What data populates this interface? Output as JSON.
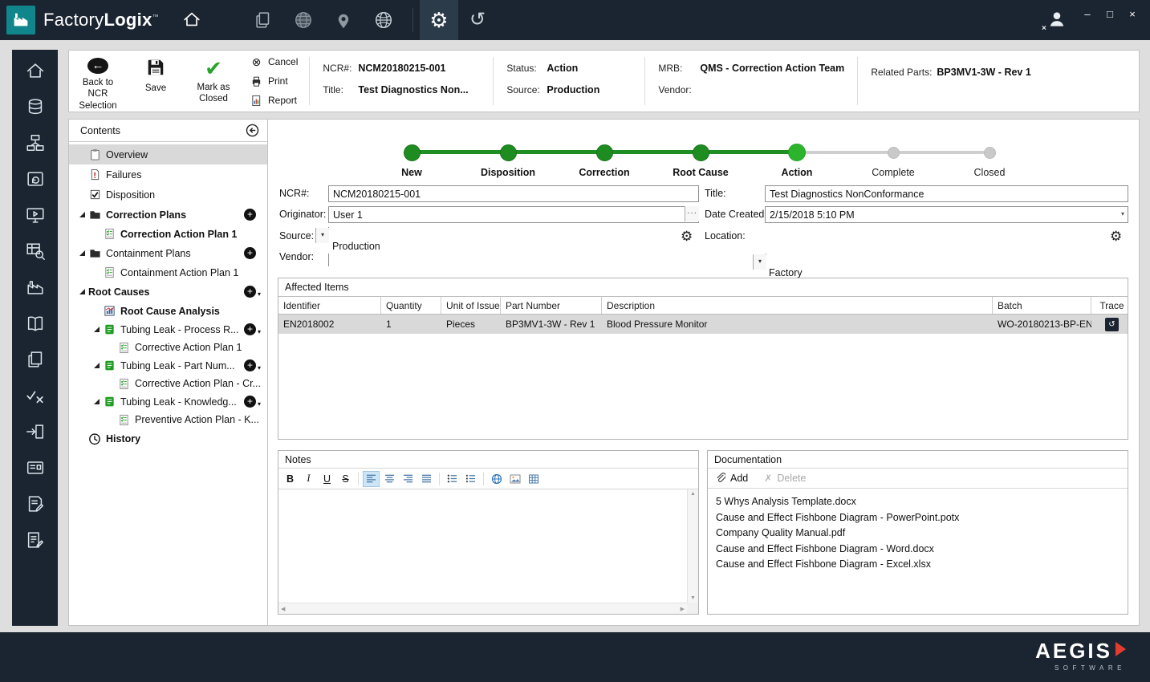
{
  "titlebar": {
    "app_name_regular": "Factory",
    "app_name_bold": "Logix",
    "trademark": "™"
  },
  "icons": {
    "gear": "⚙",
    "history": "↺",
    "back_arrow": "←",
    "cancel": "⊗",
    "check": "✔",
    "dropdown_arrow": "▾",
    "browse_ellipsis": "···",
    "minimize": "–",
    "maximize": "□",
    "close": "×",
    "scroll_up": "▲",
    "scroll_down": "▼",
    "scroll_left": "◀",
    "scroll_right": "▶",
    "trace": "↺",
    "delete_x": "✗",
    "add_plus": "+",
    "logout_x": "×"
  },
  "toolbar": {
    "back_line1": "Back to",
    "back_line2": "NCR Selection",
    "save": "Save",
    "mark_closed_line1": "Mark as",
    "mark_closed_line2": "Closed",
    "cancel": "Cancel",
    "print": "Print",
    "report": "Report",
    "info": {
      "ncr_label": "NCR#:",
      "ncr_value": "NCM20180215-001",
      "title_label": "Title:",
      "title_value": "Test Diagnostics Non...",
      "status_label": "Status:",
      "status_value": "Action",
      "source_label": "Source:",
      "source_value": "Production",
      "mrb_label": "MRB:",
      "mrb_value": "QMS - Correction Action Team",
      "vendor_label": "Vendor:",
      "vendor_value": "",
      "related_parts_label": "Related Parts:",
      "related_parts_value": "BP3MV1-3W  - Rev 1"
    }
  },
  "contents": {
    "header": "Contents",
    "items": [
      {
        "label": "Overview"
      },
      {
        "label": "Failures"
      },
      {
        "label": "Disposition"
      },
      {
        "label": "Correction Plans"
      },
      {
        "label": "Correction Action Plan 1"
      },
      {
        "label": "Containment Plans"
      },
      {
        "label": "Containment Action Plan 1"
      },
      {
        "label": "Root Causes"
      },
      {
        "label": "Root Cause Analysis"
      },
      {
        "label": "Tubing Leak - Process R..."
      },
      {
        "label": "Corrective Action Plan 1"
      },
      {
        "label": "Tubing Leak - Part Num..."
      },
      {
        "label": "Corrective Action Plan - Cr..."
      },
      {
        "label": "Tubing Leak - Knowledg..."
      },
      {
        "label": "Preventive Action Plan - K..."
      },
      {
        "label": "History"
      }
    ]
  },
  "stepper": {
    "steps": [
      {
        "label": "New"
      },
      {
        "label": "Disposition"
      },
      {
        "label": "Correction"
      },
      {
        "label": "Root Cause"
      },
      {
        "label": "Action"
      },
      {
        "label": "Complete"
      },
      {
        "label": "Closed"
      }
    ]
  },
  "form": {
    "ncr": {
      "label": "NCR#:",
      "value": "NCM20180215-001"
    },
    "title": {
      "label": "Title:",
      "value": "Test Diagnostics NonConformance"
    },
    "originator": {
      "label": "Originator:",
      "value": "User 1"
    },
    "date_created": {
      "label": "Date Created:",
      "value": "2/15/2018 5:10 PM"
    },
    "source": {
      "label": "Source:",
      "value": "Production"
    },
    "location": {
      "label": "Location:",
      "value": "Factory"
    },
    "vendor": {
      "label": "Vendor:",
      "value": ""
    }
  },
  "affected_items": {
    "title": "Affected Items",
    "columns": [
      "Identifier",
      "Quantity",
      "Unit of Issue",
      "Part Number",
      "Description",
      "Batch",
      "Trace"
    ],
    "rows": [
      {
        "identifier": "EN2018002",
        "quantity": "1",
        "unit_of_issue": "Pieces",
        "part_number": "BP3MV1-3W  - Rev 1",
        "description": "Blood Pressure Monitor",
        "batch": "WO-20180213-BP-EN"
      }
    ]
  },
  "notes": {
    "title": "Notes",
    "toolbar": {
      "bold": "B",
      "italic": "I",
      "underline": "U",
      "strikethrough": "S"
    }
  },
  "documentation": {
    "title": "Documentation",
    "add": "Add",
    "delete": "Delete",
    "files": [
      "5 Whys Analysis Template.docx",
      "Cause and Effect Fishbone Diagram - PowerPoint.potx",
      "Company Quality Manual.pdf",
      "Cause and Effect Fishbone Diagram - Word.docx",
      "Cause and Effect Fishbone Diagram - Excel.xlsx"
    ]
  },
  "footer": {
    "brand": "AEGIS",
    "brand_sub": "SOFTWARE"
  }
}
